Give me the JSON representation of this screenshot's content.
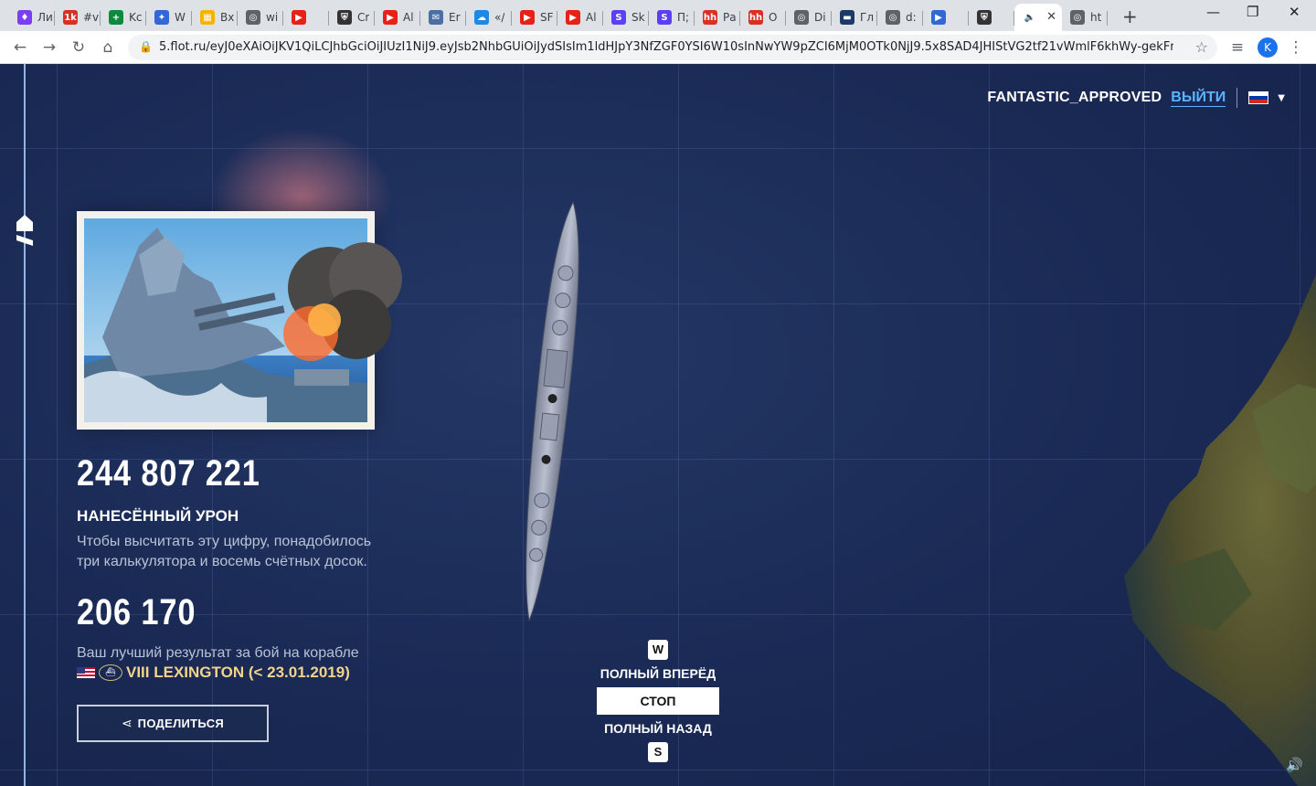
{
  "browser": {
    "tabs": [
      {
        "label": "Ли",
        "fav_color": "#7b3ff2",
        "fav_text": "♦"
      },
      {
        "label": "#v",
        "fav_color": "#d93025",
        "fav_text": "1k"
      },
      {
        "label": "Kc",
        "fav_color": "#0f8a3c",
        "fav_text": "+"
      },
      {
        "label": "W",
        "fav_color": "#3367d6",
        "fav_text": "✦"
      },
      {
        "label": "Bx",
        "fav_color": "#f4b400",
        "fav_text": "▦"
      },
      {
        "label": "wi",
        "fav_color": "#5f6368",
        "fav_text": "◎"
      },
      {
        "label": "",
        "fav_color": "#e62117",
        "fav_text": "▶"
      },
      {
        "label": "Cr",
        "fav_color": "#333333",
        "fav_text": "⛨"
      },
      {
        "label": "Al",
        "fav_color": "#e62117",
        "fav_text": "▶"
      },
      {
        "label": "Er",
        "fav_color": "#4a6fa5",
        "fav_text": "✉"
      },
      {
        "label": "«/",
        "fav_color": "#1e88e5",
        "fav_text": "☁"
      },
      {
        "label": "SF",
        "fav_color": "#e62117",
        "fav_text": "▶"
      },
      {
        "label": "Al",
        "fav_color": "#e62117",
        "fav_text": "▶"
      },
      {
        "label": "Sk",
        "fav_color": "#5b3ff2",
        "fav_text": "S"
      },
      {
        "label": "П;",
        "fav_color": "#5b3ff2",
        "fav_text": "S"
      },
      {
        "label": "Ра",
        "fav_color": "#d93025",
        "fav_text": "hh"
      },
      {
        "label": "О",
        "fav_color": "#d93025",
        "fav_text": "hh"
      },
      {
        "label": "Di",
        "fav_color": "#5f6368",
        "fav_text": "◎"
      },
      {
        "label": "Гл",
        "fav_color": "#1b3a66",
        "fav_text": "▬"
      },
      {
        "label": "d:",
        "fav_color": "#5f6368",
        "fav_text": "◎"
      },
      {
        "label": "",
        "fav_color": "#3367d6",
        "fav_text": "▶"
      },
      {
        "label": "",
        "fav_color": "#333333",
        "fav_text": "⛨"
      },
      {
        "label": "",
        "fav_color": "#ffffff",
        "fav_text": "🔈"
      },
      {
        "label": "ht",
        "fav_color": "#5f6368",
        "fav_text": "◎"
      }
    ],
    "new_tab": "+",
    "url": "5.flot.ru/eyJ0eXAiOiJKV1QiLCJhbGciOiJIUzI1NiJ9.eyJsb2NhbGUiOiJydSIsIm1ldHJpY3NfZGF0YSI6W10sInNwYW9pZCI6MjM0OTk0NjJ9.5x8SAD4JHIStVG2tf21vWmlF6khWy-gekFmkAG...",
    "profile_initial": "K"
  },
  "user": {
    "name": "FANTASTIC_APPROVED",
    "logout": "ВЫЙТИ",
    "flag_colors": [
      "#ffffff",
      "#0039a6",
      "#d52b1e"
    ]
  },
  "stats": {
    "damage_value": "244 807 221",
    "damage_title": "НАНЕСЁННЫЙ УРОН",
    "damage_desc_line1": "Чтобы высчитать эту цифру, понадобилось",
    "damage_desc_line2": "три калькулятора и восемь счётных досок.",
    "best_value": "206 170",
    "best_desc": "Ваш лучший результат за бой на корабле",
    "best_ship": "VIII LEXINGTON (< 23.01.2019)"
  },
  "share": {
    "label": "ПОДЕЛИТЬСЯ",
    "icon": "share-icon"
  },
  "controls": {
    "key_up": "W",
    "forward": "ПОЛНЫЙ ВПЕРЁД",
    "stop": "СТОП",
    "reverse": "ПОЛНЫЙ НАЗАД",
    "key_down": "S",
    "selected": "stop"
  },
  "colors": {
    "ocean": "#1a2a55",
    "accent": "#5bb4ff",
    "ship_name": "#f2d38c"
  }
}
